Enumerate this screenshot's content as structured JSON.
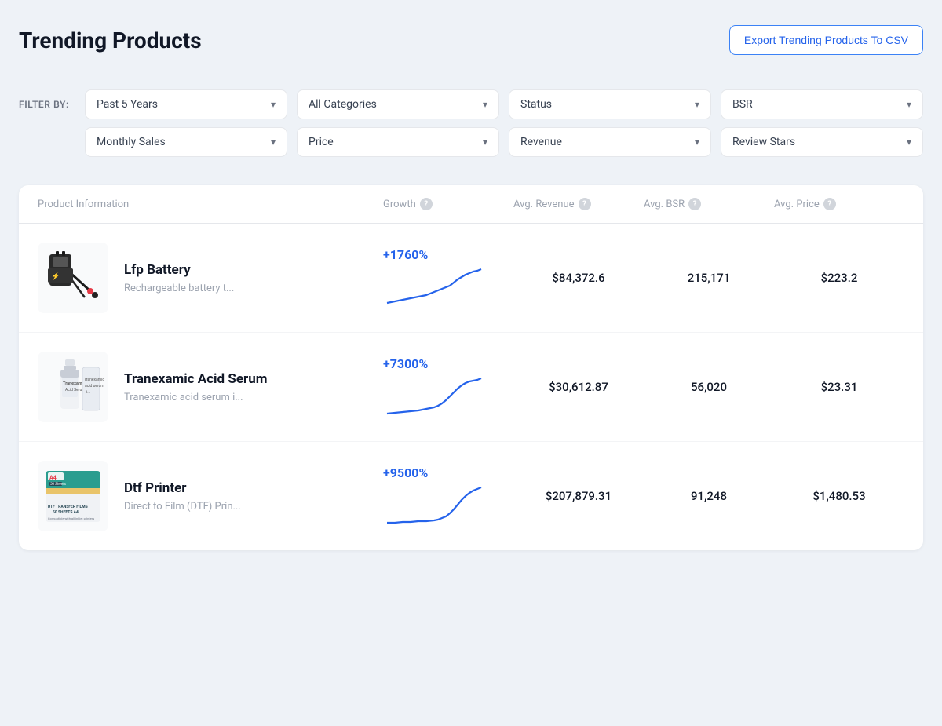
{
  "page": {
    "title": "Trending Products",
    "export_button": "Export Trending Products To CSV"
  },
  "filters": {
    "label": "FILTER BY:",
    "row1": [
      {
        "id": "time",
        "label": "Past 5 Years"
      },
      {
        "id": "category",
        "label": "All Categories"
      },
      {
        "id": "status",
        "label": "Status"
      },
      {
        "id": "bsr",
        "label": "BSR"
      }
    ],
    "row2": [
      {
        "id": "monthly_sales",
        "label": "Monthly Sales"
      },
      {
        "id": "price",
        "label": "Price"
      },
      {
        "id": "revenue",
        "label": "Revenue"
      },
      {
        "id": "review_stars",
        "label": "Review Stars"
      }
    ]
  },
  "table": {
    "headers": [
      {
        "id": "product_info",
        "label": "Product Information",
        "help": false
      },
      {
        "id": "growth",
        "label": "Growth",
        "help": true
      },
      {
        "id": "avg_revenue",
        "label": "Avg. Revenue",
        "help": true
      },
      {
        "id": "avg_bsr",
        "label": "Avg. BSR",
        "help": true
      },
      {
        "id": "avg_price",
        "label": "Avg. Price",
        "help": true
      }
    ],
    "rows": [
      {
        "id": "lfp-battery",
        "name": "Lfp Battery",
        "desc": "Rechargeable battery t...",
        "growth": "+1760%",
        "avg_revenue": "$84,372.6",
        "avg_bsr": "215,171",
        "avg_price": "$223.2",
        "chart_type": "gradual_rise"
      },
      {
        "id": "tranexamic-acid-serum",
        "name": "Tranexamic Acid Serum",
        "desc": "Tranexamic acid serum i...",
        "growth": "+7300%",
        "avg_revenue": "$30,612.87",
        "avg_bsr": "56,020",
        "avg_price": "$23.31",
        "chart_type": "sharp_rise"
      },
      {
        "id": "dtf-printer",
        "name": "Dtf Printer",
        "desc": "Direct to Film (DTF) Prin...",
        "growth": "+9500%",
        "avg_revenue": "$207,879.31",
        "avg_bsr": "91,248",
        "avg_price": "$1,480.53",
        "chart_type": "late_rise"
      }
    ]
  }
}
